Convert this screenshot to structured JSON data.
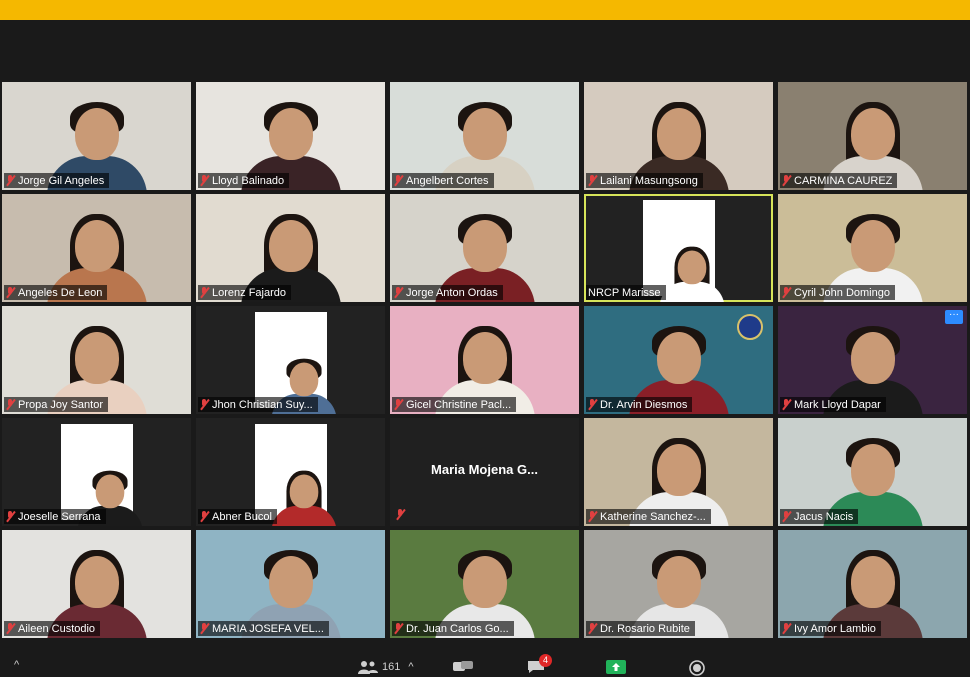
{
  "participants": [
    {
      "name": "Jorge Gil Angeles",
      "bg": "#d9d6cf",
      "body": "#2f4a66",
      "hair": "short"
    },
    {
      "name": "Lloyd Balinado",
      "bg": "#e7e4df",
      "body": "#3a2326",
      "hair": "short"
    },
    {
      "name": "Angelbert Cortes",
      "bg": "#d8ddd9",
      "body": "#d7d1c3",
      "hair": "short"
    },
    {
      "name": "Lailani Masungsong",
      "bg": "#d5cbbf",
      "body": "#3a2a24",
      "hair": "long"
    },
    {
      "name": "CARMINA CAUREZ",
      "bg": "#8a8070",
      "body": "#d8d3cc",
      "hair": "long"
    },
    {
      "name": "Angeles De Leon",
      "bg": "#c7bcae",
      "body": "#b9764e",
      "hair": "long"
    },
    {
      "name": "Lorenz Fajardo",
      "bg": "#e1dbd0",
      "body": "#1b1b1b",
      "hair": "long"
    },
    {
      "name": "Jorge Anton Ordas",
      "bg": "#d6d3cb",
      "body": "#7a2024",
      "hair": "short"
    },
    {
      "name": "NRCP Marisse",
      "bg": "#222222",
      "body": "#ffffff",
      "hair": "long",
      "active": true,
      "thumb": true
    },
    {
      "name": "Cyril John Domingo",
      "bg": "#cbbd98",
      "body": "#f1f1f1",
      "hair": "short"
    },
    {
      "name": "Propa Joy Santor",
      "bg": "#dfddd6",
      "body": "#e9d0c0",
      "hair": "long"
    },
    {
      "name": "Jhon Christian Suy...",
      "bg": "#222222",
      "body": "#4f6f96",
      "hair": "short",
      "thumb": true
    },
    {
      "name": "Gicel Christine Pacl...",
      "bg": "#e8b0c2",
      "body": "#f1ede6",
      "hair": "long"
    },
    {
      "name": "Dr. Arvin Diesmos",
      "bg": "#2f6d80",
      "body": "#8a1f28",
      "hair": "short",
      "logo": true
    },
    {
      "name": "Mark Lloyd Dapar",
      "bg": "#3a2440",
      "body": "#1b1b1b",
      "hair": "short",
      "more": true
    },
    {
      "name": "Joeselle Serrana",
      "bg": "#222222",
      "body": "#1b1b1b",
      "hair": "short",
      "thumb": true
    },
    {
      "name": "Abner Bucol",
      "bg": "#222222",
      "body": "#b32a2a",
      "hair": "long",
      "thumb": true
    },
    {
      "name": "Maria Mojena G...",
      "bg": "#202020",
      "novideo": true
    },
    {
      "name": "Katherine Sanchez-...",
      "bg": "#c4b79e",
      "body": "#eeeeee",
      "hair": "long"
    },
    {
      "name": "Jacus Nacis",
      "bg": "#c9d0cd",
      "body": "#2c8a57",
      "hair": "short"
    },
    {
      "name": "Aileen Custodio",
      "bg": "#e3e2df",
      "body": "#6a2a33",
      "hair": "long"
    },
    {
      "name": "MARIA JOSEFA VEL...",
      "bg": "#8fb4c4",
      "body": "#8fa2b3",
      "hair": "short"
    },
    {
      "name": "Dr. Juan Carlos Go...",
      "bg": "#5a7b40",
      "body": "#e8e8e8",
      "hair": "short"
    },
    {
      "name": "Dr. Rosario Rubite",
      "bg": "#a7a6a1",
      "body": "#e6e6e6",
      "hair": "short"
    },
    {
      "name": "Ivy Amor Lambio",
      "bg": "#8ca6ae",
      "body": "#5b3a3a",
      "hair": "long"
    }
  ],
  "toolbar": {
    "participants_count": "161",
    "chat_badge": "4",
    "up_caret": "^"
  },
  "colors": {
    "top_bar": "#f5b800",
    "active_speaker": "#d7e45a",
    "muted": "#e04040",
    "share_green": "#21b35a"
  }
}
